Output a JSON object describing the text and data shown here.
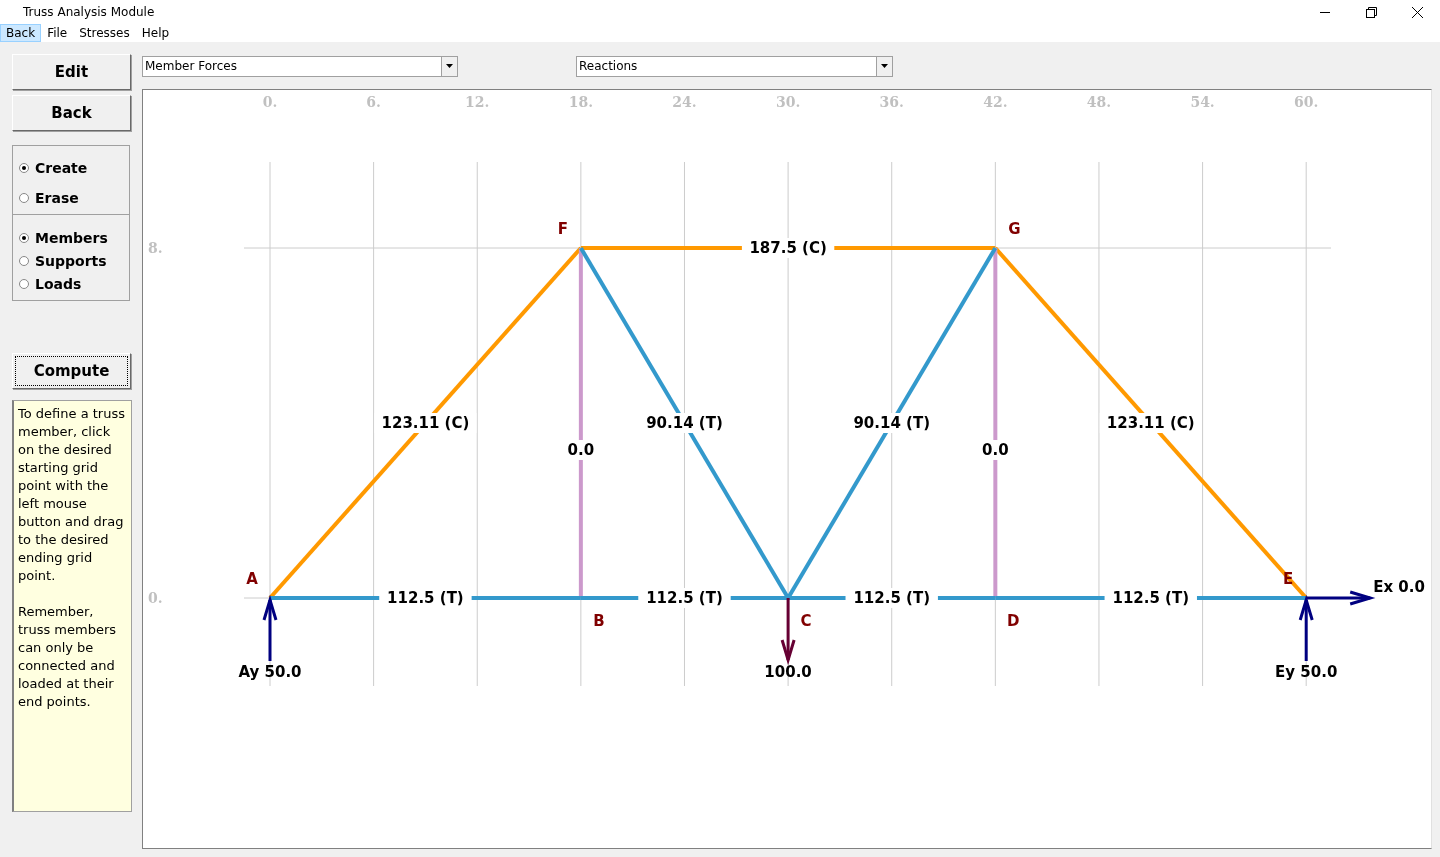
{
  "window": {
    "title": "Truss Analysis Module"
  },
  "menu": [
    {
      "label": "Back",
      "selected": true
    },
    {
      "label": "File",
      "selected": false
    },
    {
      "label": "Stresses",
      "selected": false
    },
    {
      "label": "Help",
      "selected": false
    }
  ],
  "buttons_top": [
    {
      "label": "Edit"
    },
    {
      "label": "Back"
    }
  ],
  "radio_groups": [
    [
      {
        "label": "Create",
        "selected": true
      },
      {
        "label": "Erase",
        "selected": false
      }
    ],
    [
      {
        "label": "Members",
        "selected": true
      },
      {
        "label": "Supports",
        "selected": false
      },
      {
        "label": "Loads",
        "selected": false
      }
    ]
  ],
  "compute_button": {
    "label": "Compute",
    "focused": true
  },
  "help_text": [
    "To define a truss member, click on the desired starting grid point with the left mouse button and drag to the desired ending grid point.",
    "Remember, truss members can only be connected and loaded at their end points."
  ],
  "dropdowns": [
    {
      "value": "Member Forces"
    },
    {
      "value": "Reactions"
    }
  ],
  "grid": {
    "x_ticks": [
      "0.",
      "6.",
      "12.",
      "18.",
      "24.",
      "30.",
      "36.",
      "42.",
      "48.",
      "54.",
      "60."
    ],
    "y_ticks": [
      "8.",
      "0."
    ]
  },
  "nodes": [
    {
      "name": "A"
    },
    {
      "name": "B"
    },
    {
      "name": "C"
    },
    {
      "name": "D"
    },
    {
      "name": "E"
    },
    {
      "name": "F"
    },
    {
      "name": "G"
    }
  ],
  "members": [
    {
      "kind": "compression",
      "force": "123.11 (C)"
    },
    {
      "kind": "compression",
      "force": "187.5 (C)"
    },
    {
      "kind": "compression",
      "force": "123.11 (C)"
    },
    {
      "kind": "zero",
      "force": "0.0"
    },
    {
      "kind": "zero",
      "force": "0.0"
    },
    {
      "kind": "tension",
      "force": "90.14 (T)"
    },
    {
      "kind": "tension",
      "force": "90.14 (T)"
    },
    {
      "kind": "tension",
      "force": "112.5 (T)"
    },
    {
      "kind": "tension",
      "force": "112.5 (T)"
    },
    {
      "kind": "tension",
      "force": "112.5 (T)"
    },
    {
      "kind": "tension",
      "force": "112.5 (T)"
    }
  ],
  "forces": [
    {
      "kind": "reaction",
      "label": "Ay 50.0"
    },
    {
      "kind": "load",
      "label": "100.0"
    },
    {
      "kind": "reaction",
      "label": "Ey 50.0"
    },
    {
      "kind": "reaction",
      "label": "Ex 0.0"
    }
  ]
}
